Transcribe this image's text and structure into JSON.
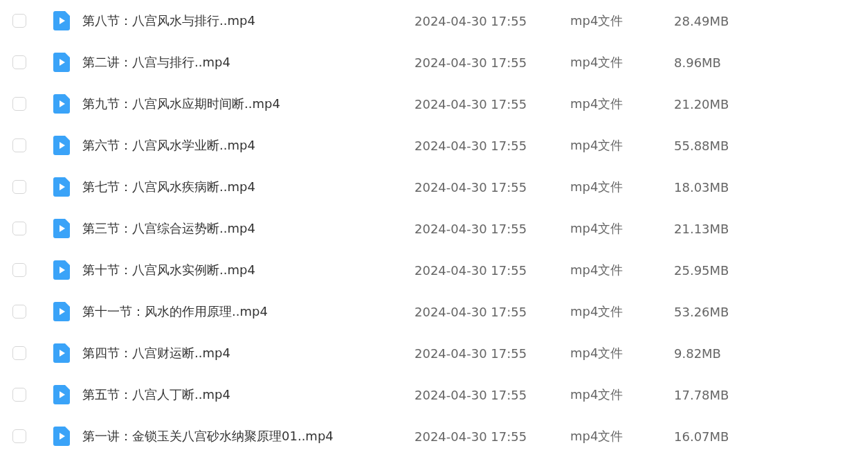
{
  "files": [
    {
      "name": "第八节：八宫风水与排行..mp4",
      "modified": "2024-04-30 17:55",
      "type": "mp4文件",
      "size": "28.49MB",
      "checked": false
    },
    {
      "name": "第二讲：八宫与排行..mp4",
      "modified": "2024-04-30 17:55",
      "type": "mp4文件",
      "size": "8.96MB",
      "checked": false
    },
    {
      "name": "第九节：八宫风水应期时间断..mp4",
      "modified": "2024-04-30 17:55",
      "type": "mp4文件",
      "size": "21.20MB",
      "checked": false
    },
    {
      "name": "第六节：八宫风水学业断..mp4",
      "modified": "2024-04-30 17:55",
      "type": "mp4文件",
      "size": "55.88MB",
      "checked": false
    },
    {
      "name": "第七节：八宫风水疾病断..mp4",
      "modified": "2024-04-30 17:55",
      "type": "mp4文件",
      "size": "18.03MB",
      "checked": false
    },
    {
      "name": "第三节：八宫综合运势断..mp4",
      "modified": "2024-04-30 17:55",
      "type": "mp4文件",
      "size": "21.13MB",
      "checked": false
    },
    {
      "name": "第十节：八宫风水实例断..mp4",
      "modified": "2024-04-30 17:55",
      "type": "mp4文件",
      "size": "25.95MB",
      "checked": false
    },
    {
      "name": "第十一节：风水的作用原理..mp4",
      "modified": "2024-04-30 17:55",
      "type": "mp4文件",
      "size": "53.26MB",
      "checked": false
    },
    {
      "name": "第四节：八宫财运断..mp4",
      "modified": "2024-04-30 17:55",
      "type": "mp4文件",
      "size": "9.82MB",
      "checked": false
    },
    {
      "name": "第五节：八宫人丁断..mp4",
      "modified": "2024-04-30 17:55",
      "type": "mp4文件",
      "size": "17.78MB",
      "checked": false
    },
    {
      "name": "第一讲：金锁玉关八宫砂水纳聚原理01..mp4",
      "modified": "2024-04-30 17:55",
      "type": "mp4文件",
      "size": "16.07MB",
      "checked": false
    }
  ]
}
